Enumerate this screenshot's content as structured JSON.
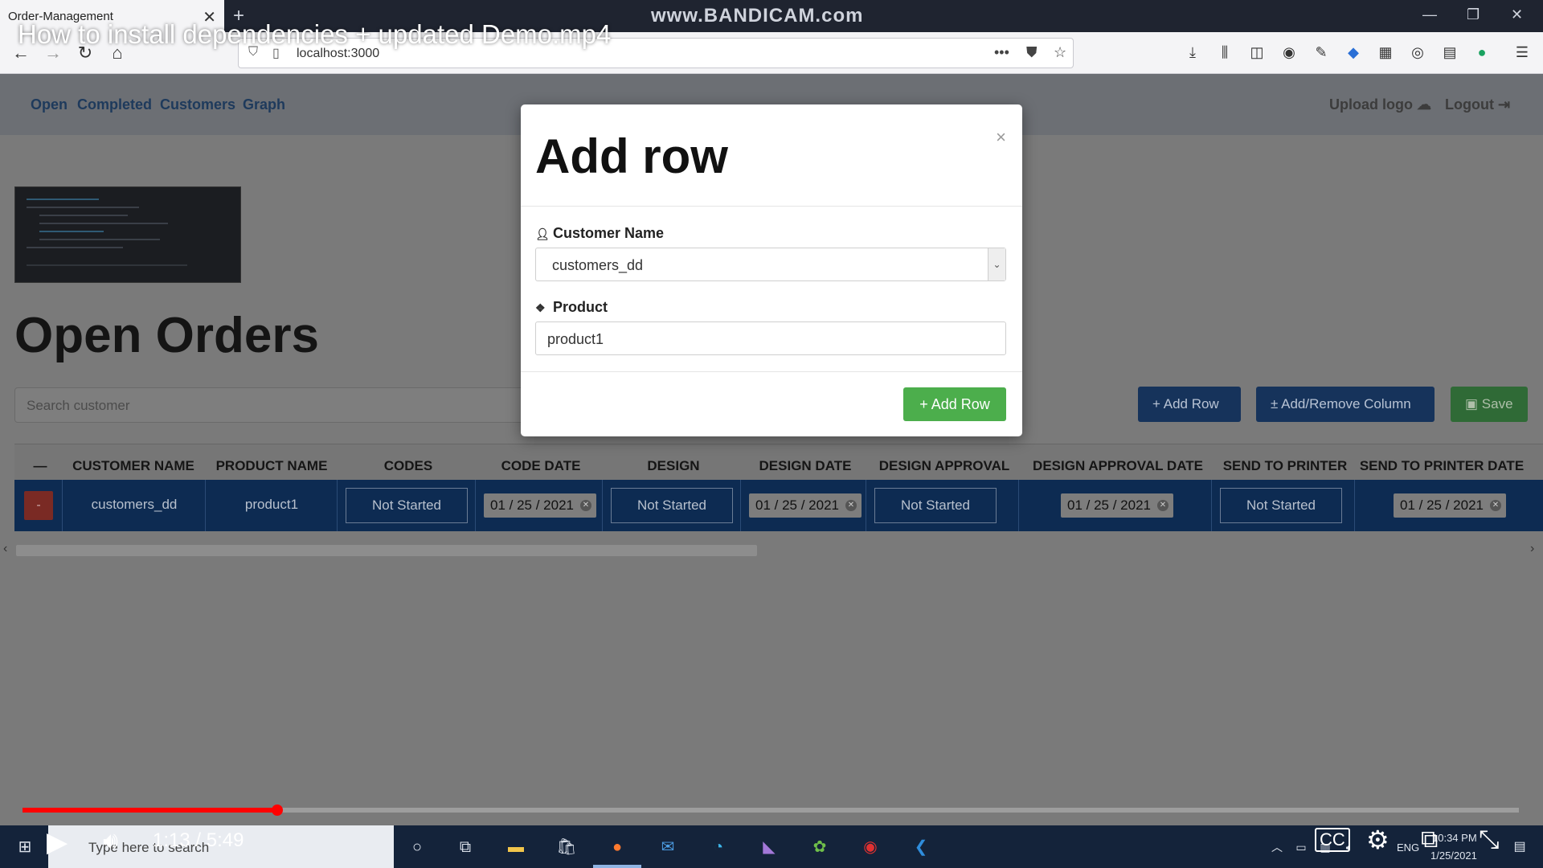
{
  "browser": {
    "tab_title": "Order-Management",
    "tab_close": "✕",
    "new_tab": "+",
    "watermark": "www.BANDICAM.com",
    "url": "localhost:3000"
  },
  "app_nav": {
    "links": [
      "Open",
      "Completed",
      "Customers",
      "Graph"
    ],
    "upload_logo": "Upload logo",
    "logout": "Logout"
  },
  "page": {
    "title": "Open Orders",
    "search_placeholder": "Search customer",
    "add_row_button": "Add Row",
    "add_remove_column_button": "Add/Remove Column",
    "save_button": "Save"
  },
  "table": {
    "headers": [
      "—",
      "CUSTOMER NAME",
      "PRODUCT NAME",
      "CODES",
      "CODE DATE",
      "DESIGN",
      "DESIGN DATE",
      "DESIGN APPROVAL",
      "DESIGN APPROVAL DATE",
      "SEND TO PRINTER",
      "SEND TO PRINTER DATE"
    ],
    "row": {
      "delete": "-",
      "customer": "customers_dd",
      "product": "product1",
      "codes": "Not Started",
      "code_date": "01 / 25 / 2021",
      "design": "Not Started",
      "design_date": "01 / 25 / 2021",
      "design_approval": "Not Started",
      "design_approval_date": "01 / 25 / 2021",
      "send_to_printer": "Not Started",
      "send_to_printer_date": "01 / 25 / 2021"
    }
  },
  "modal": {
    "title": "Add row",
    "close": "×",
    "customer_label": "Customer Name",
    "customer_value": "customers_dd",
    "product_label": "Product",
    "product_value": "product1",
    "submit": "Add Row"
  },
  "video": {
    "title": "How to install dependencies + updated Demo.mp4",
    "time": "1:13 / 5:49",
    "progress": 0.17
  },
  "taskbar": {
    "search_placeholder": "Type here to search",
    "lang": "ENG",
    "clock_time": "10:34 PM",
    "clock_date": "1/25/2021"
  },
  "colors": {
    "accent_green": "#4cae4c",
    "table_row_blue": "#0d2b52",
    "progress_red": "#ff0000"
  }
}
